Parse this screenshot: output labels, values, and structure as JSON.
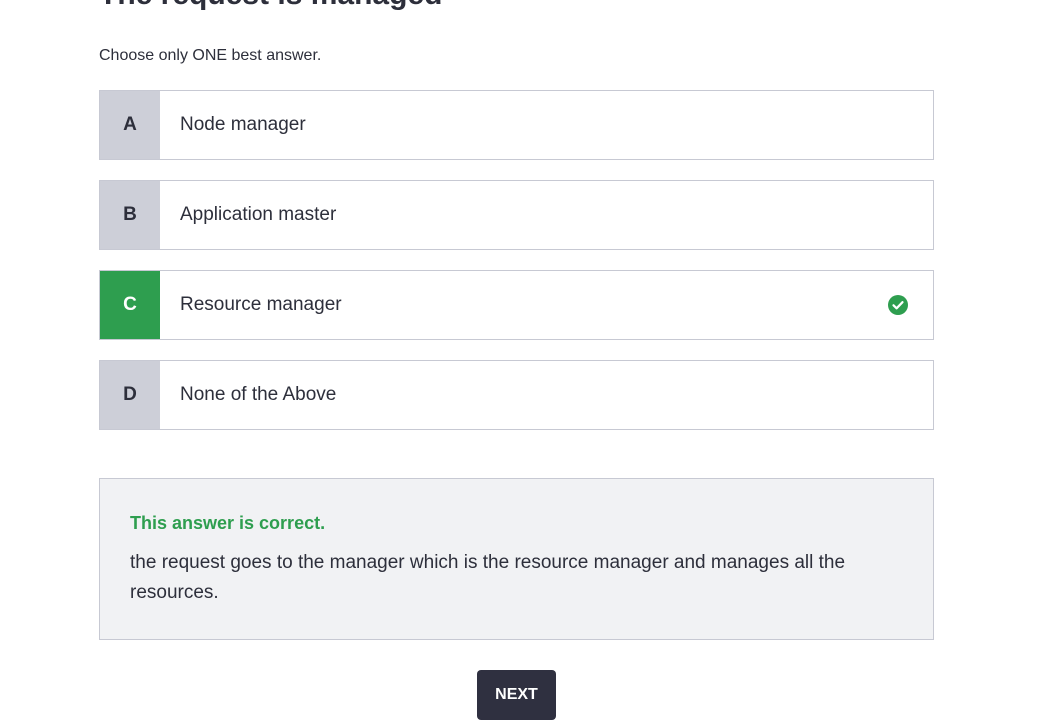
{
  "question": {
    "title_partial": "The request is managed"
  },
  "instruction": "Choose only ONE best answer.",
  "options": [
    {
      "letter": "A",
      "text": "Node manager",
      "correct": false
    },
    {
      "letter": "B",
      "text": "Application master",
      "correct": false
    },
    {
      "letter": "C",
      "text": "Resource manager",
      "correct": true
    },
    {
      "letter": "D",
      "text": "None of the Above",
      "correct": false
    }
  ],
  "feedback": {
    "status": "This answer is correct.",
    "explanation": "the request goes to the manager which is the resource manager and manages all the resources."
  },
  "next_button": {
    "label": "NEXT"
  },
  "colors": {
    "correct_green": "#2e9e4f",
    "letter_bg": "#cdcfd8",
    "button_dark": "#2f3040",
    "feedback_bg": "#f1f2f4",
    "text_dark": "#2d2f3b"
  },
  "icons": {
    "correct_marker": "check-circle-icon"
  }
}
